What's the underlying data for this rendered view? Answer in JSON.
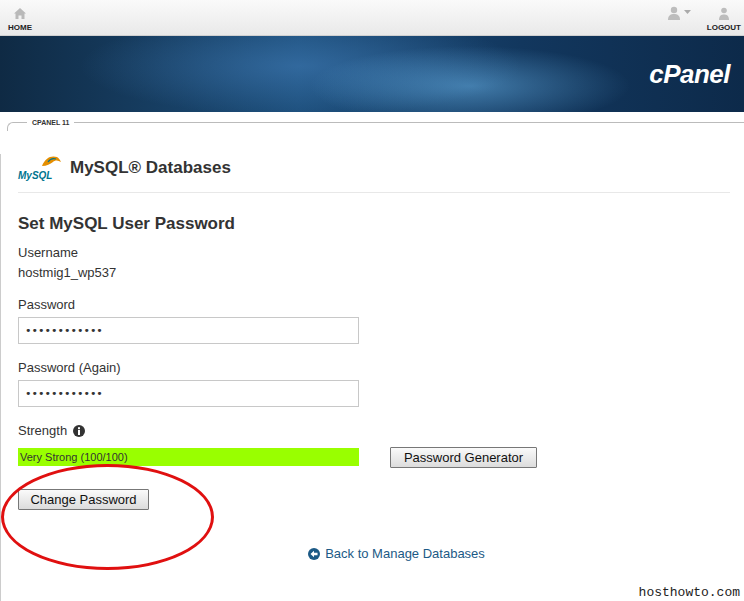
{
  "header": {
    "home_label": "HOME",
    "logout_label": "LOGOUT"
  },
  "banner": {
    "logo": "cPanel",
    "version": "CPANEL 11"
  },
  "page": {
    "logo_text": "MySQL",
    "title": "MySQL® Databases"
  },
  "form": {
    "title": "Set MySQL User Password",
    "username_label": "Username",
    "username": "hostmig1_wp537",
    "fields": [
      {
        "label": "Password",
        "value": "••••••••••••"
      },
      {
        "label": "Password (Again)",
        "value": "••••••••••••"
      }
    ],
    "strength": {
      "label": "Strength",
      "level": 1,
      "reading": "Very Strong (100/100)"
    },
    "generator_button": "Password Generator",
    "submit_button": {
      "label": "Change Password",
      "highlighted": true
    }
  },
  "back_link": "Back to Manage Databases",
  "watermark": "hosthowto.com"
}
